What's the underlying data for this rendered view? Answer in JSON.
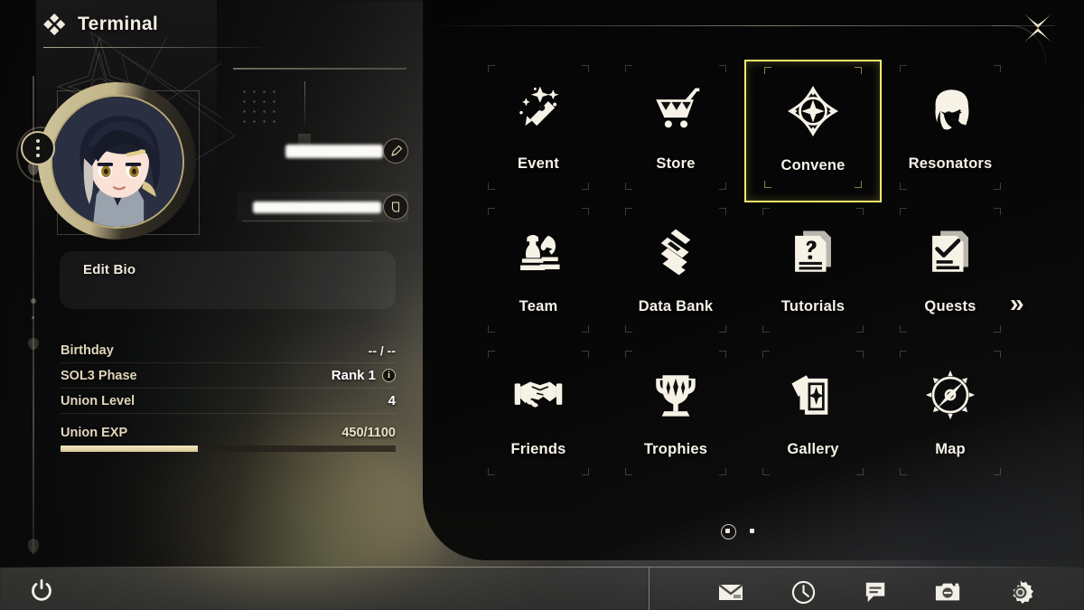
{
  "header": {
    "title": "Terminal",
    "icon": "terminal-diamonds-icon"
  },
  "close_button": {
    "icon": "close-star-icon"
  },
  "profile": {
    "avatar": {
      "icon": "character-avatar"
    },
    "options_button": {
      "icon": "more-vertical-icon"
    },
    "name": {
      "value": "",
      "censored": true,
      "edit_icon": "pencil-icon"
    },
    "uid": {
      "value": "",
      "censored": true,
      "copy_icon": "copy-icon"
    },
    "bio": {
      "label": "Edit Bio"
    },
    "stats": [
      {
        "label": "Birthday",
        "value": "-- / --",
        "info": false
      },
      {
        "label": "SOL3 Phase",
        "value": "Rank 1",
        "info": true,
        "info_glyph": "i"
      },
      {
        "label": "Union Level",
        "value": "4",
        "info": false
      }
    ],
    "exp": {
      "label": "Union EXP",
      "value": "450/1100",
      "current": 450,
      "max": 1100,
      "percent": 41
    }
  },
  "menu": {
    "tiles": [
      {
        "label": "Event",
        "icon": "magic-wand-stars-icon",
        "selected": false
      },
      {
        "label": "Store",
        "icon": "shopping-cart-icon",
        "selected": false
      },
      {
        "label": "Convene",
        "icon": "convene-compass-star-icon",
        "selected": true
      },
      {
        "label": "Resonators",
        "icon": "character-head-icon",
        "selected": false
      },
      {
        "label": "Team",
        "icon": "chess-pieces-icon",
        "selected": false
      },
      {
        "label": "Data Bank",
        "icon": "stacked-diamonds-icon",
        "selected": false
      },
      {
        "label": "Tutorials",
        "icon": "question-document-icon",
        "selected": false
      },
      {
        "label": "Quests",
        "icon": "checklist-document-icon",
        "selected": false
      },
      {
        "label": "Friends",
        "icon": "handshake-icon",
        "selected": false
      },
      {
        "label": "Trophies",
        "icon": "trophy-icon",
        "selected": false
      },
      {
        "label": "Gallery",
        "icon": "cards-stack-icon",
        "selected": false
      },
      {
        "label": "Map",
        "icon": "compass-icon",
        "selected": false
      }
    ],
    "next_page": {
      "label": "»",
      "icon": "double-chevron-right-icon"
    },
    "pages": {
      "count": 2,
      "active": 1
    }
  },
  "bottom_bar": {
    "power": {
      "icon": "power-icon"
    },
    "icons": [
      {
        "icon": "mail-icon"
      },
      {
        "icon": "clock-icon"
      },
      {
        "icon": "announcement-icon"
      },
      {
        "icon": "camera-icon"
      },
      {
        "icon": "gear-icon"
      }
    ]
  },
  "colors": {
    "accent_selected": "#f2e96b",
    "gold": "#cfc29a",
    "cream": "#f3eee1",
    "exp_fill": "#e8d9a8",
    "panel_dark": "#060606"
  }
}
